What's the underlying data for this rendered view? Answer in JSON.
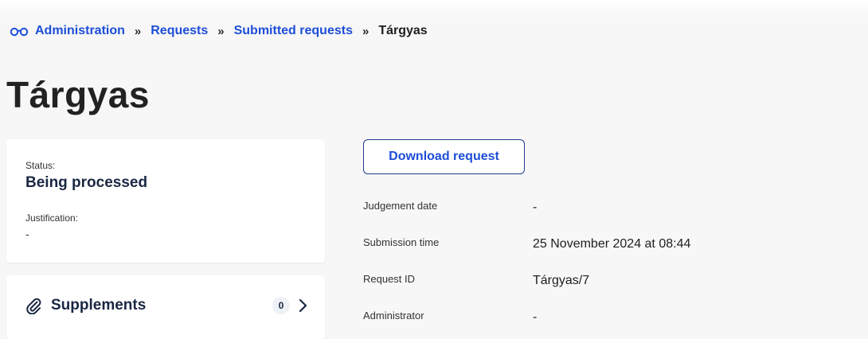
{
  "breadcrumb": {
    "icon": "glasses-icon",
    "items": [
      "Administration",
      "Requests",
      "Submitted requests"
    ],
    "separator": "»",
    "current": "Tárgyas"
  },
  "page": {
    "title": "Tárgyas"
  },
  "status_card": {
    "status_label": "Status:",
    "status_value": "Being processed",
    "justification_label": "Justification:",
    "justification_value": "-"
  },
  "supplements": {
    "icon": "paperclip-icon",
    "title": "Supplements",
    "count": "0",
    "chevron": "chevron-right-icon"
  },
  "actions": {
    "download_label": "Download request"
  },
  "details": [
    {
      "label": "Judgement date",
      "value": "-"
    },
    {
      "label": "Submission time",
      "value": "25 November 2024 at 08:44"
    },
    {
      "label": "Request ID",
      "value": "Tárgyas/7"
    },
    {
      "label": "Administrator",
      "value": "-"
    }
  ],
  "colors": {
    "link": "#1d4ed8",
    "navy": "#1a2744",
    "background": "#f7f7f7",
    "card": "#ffffff"
  }
}
